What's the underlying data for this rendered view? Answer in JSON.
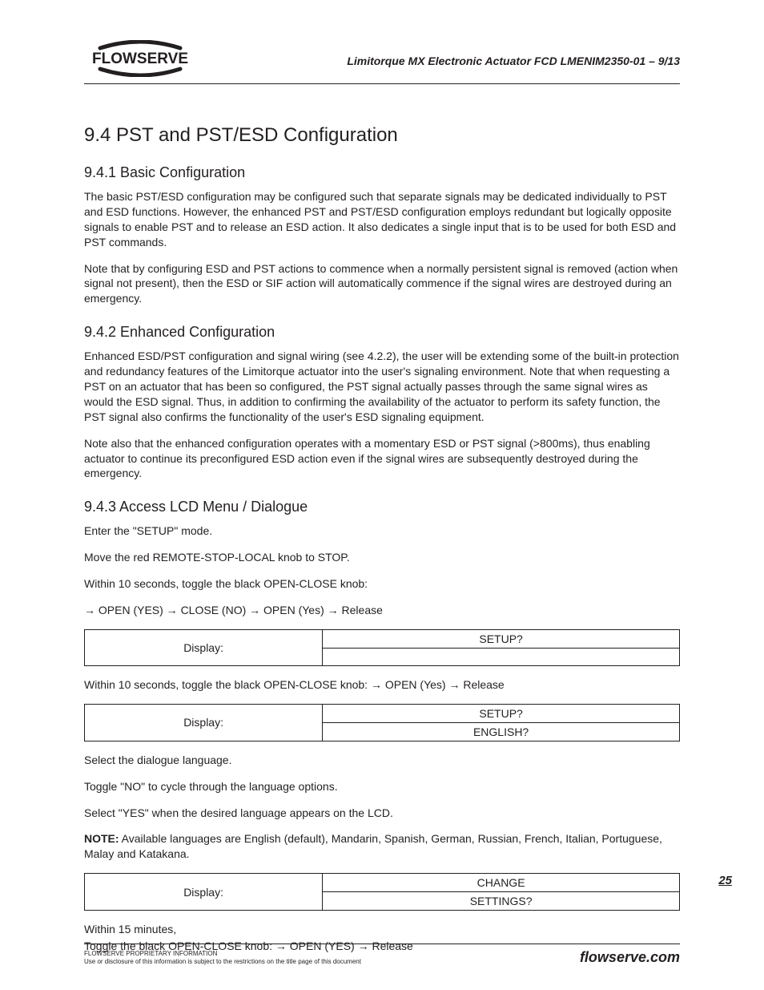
{
  "header": {
    "logo_alt": "Flowserve logo",
    "logo_text": "FLOWSERVE",
    "doc_title": "Limitorque MX Electronic Actuator   FCD LMENIM2350-01 – 9/13"
  },
  "sections": {
    "h1": "9.4 PST and PST/ESD Configuration",
    "s941": {
      "title": "9.4.1 Basic Configuration",
      "p1": "The basic PST/ESD configuration may be configured such that separate signals may be dedicated individually to PST and ESD functions. However, the enhanced PST and PST/ESD configuration employs redundant but logically opposite signals to enable PST and to release an ESD action. It also dedicates a single input that is to be used for both ESD and PST commands.",
      "p2": "Note that by configuring ESD and PST actions to commence when a normally persistent signal is removed (action when signal not present), then the ESD or SIF action will automatically commence if the signal wires are destroyed during an emergency."
    },
    "s942": {
      "title": "9.4.2 Enhanced Configuration",
      "p1": "Enhanced ESD/PST configuration and signal wiring (see 4.2.2), the user will be extending some of the built-in protection and redundancy features of the Limitorque actuator into the user's signaling environment. Note that when requesting a PST on an actuator that has been so configured, the PST signal actually passes through the same signal wires as would the ESD signal. Thus, in addition to confirming the availability of the actuator to perform its safety function, the PST signal also confirms the functionality of the user's ESD signaling equipment.",
      "p2": "Note also that the enhanced configuration operates with a momentary ESD or PST signal (>800ms), thus enabling actuator to continue its preconfigured ESD action even if the signal wires are subsequently destroyed during the emergency."
    },
    "s943": {
      "title": "9.4.3 Access LCD Menu / Dialogue",
      "p1": "Enter the \"SETUP\" mode.",
      "p2": "Move the red REMOTE-STOP-LOCAL knob to STOP.",
      "p3": "Within 10 seconds, toggle the black OPEN-CLOSE knob:",
      "p4": "→ OPEN (YES) → CLOSE (NO) → OPEN (Yes) → Release",
      "p5": "Within 10 seconds, toggle the black OPEN-CLOSE knob: → OPEN (Yes) → Release",
      "p6": "Select the dialogue language.",
      "p7": "Toggle \"NO\" to cycle through the language options.",
      "p8": "Select \"YES\" when the desired language appears on the LCD.",
      "note_label": "NOTE:",
      "note_text": " Available languages are English (default), Mandarin, Spanish, German, Russian, French, Italian, Portuguese, Malay and Katakana.",
      "p9": "Within 15 minutes,",
      "p10": "Toggle the black OPEN-CLOSE knob: → OPEN (YES) → Release"
    }
  },
  "tables": {
    "display_label": "Display:",
    "t1": {
      "r1": "SETUP?",
      "r2": ""
    },
    "t2": {
      "r1": "SETUP?",
      "r2": "ENGLISH?"
    },
    "t3": {
      "r1": "CHANGE",
      "r2": "SETTINGS?"
    }
  },
  "page_number": "25",
  "footer": {
    "line1": "FLOWSERVE PROPRIETARY INFORMATION",
    "line2": "Use or disclosure of this information is subject to the restrictions on the title page of this document",
    "site": "flowserve.com"
  }
}
